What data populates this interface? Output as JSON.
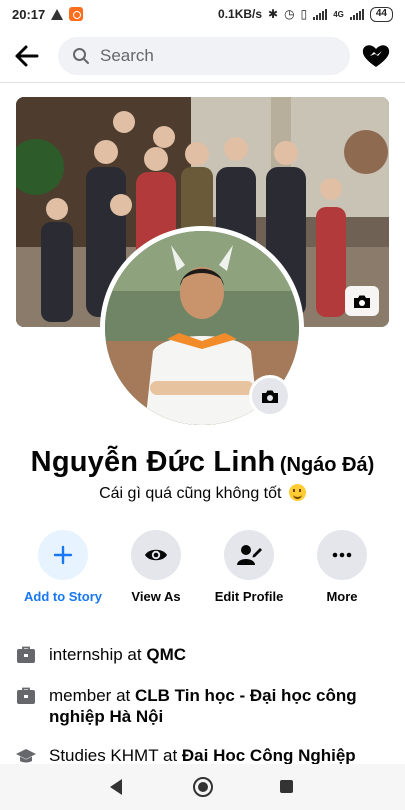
{
  "status_bar": {
    "time": "20:17",
    "speed": "0.1KB/s",
    "network": "4G",
    "battery": "44"
  },
  "header": {
    "search_placeholder": "Search"
  },
  "profile": {
    "name": "Nguyễn Đức Linh",
    "nickname": "(Ngáo Đá)",
    "bio": "Cái gì quá cũng không tốt"
  },
  "actions": [
    {
      "label": "Add to Story",
      "icon": "plus-icon"
    },
    {
      "label": "View As",
      "icon": "eye-icon"
    },
    {
      "label": "Edit Profile",
      "icon": "edit-profile-icon"
    },
    {
      "label": "More",
      "icon": "more-dots-icon"
    }
  ],
  "intro": [
    {
      "prefix": "internship at ",
      "place": "QMC"
    },
    {
      "prefix": "member at ",
      "place": "CLB Tin học - Đại học công nghiệp Hà Nội"
    },
    {
      "prefix": "Studies KHMT at ",
      "place": "Đai Hoc Công Nghiệp"
    }
  ],
  "colors": {
    "accent": "#1877f2",
    "button_bg": "#e4e6eb",
    "accent_bg": "#e7f3ff",
    "text": "#050505",
    "muted": "#65676b"
  }
}
